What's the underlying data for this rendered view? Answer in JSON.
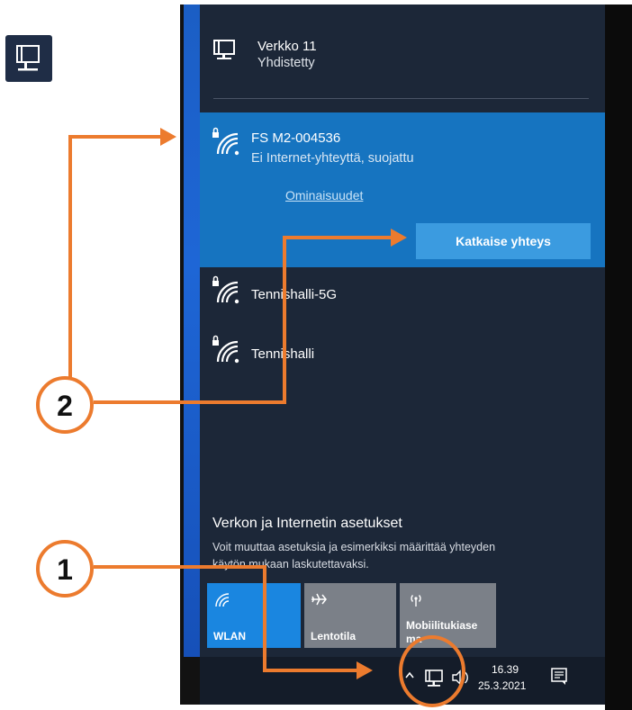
{
  "wired": {
    "name": "Verkko 11",
    "status": "Yhdistetty"
  },
  "selected_wifi": {
    "name": "FS M2-004536",
    "status": "Ei Internet-yhteyttä, suojattu",
    "properties_link": "Ominaisuudet",
    "disconnect_button": "Katkaise yhteys"
  },
  "wifi_networks": [
    {
      "name": "Tennishalli-5G"
    },
    {
      "name": "Tennishalli"
    }
  ],
  "settings": {
    "title": "Verkon ja Internetin asetukset",
    "desc_line1": "Voit muuttaa asetuksia ja esimerkiksi määrittää yhteyden",
    "desc_line2": "käytön mukaan laskutettavaksi."
  },
  "quick_tiles": [
    {
      "label": "WLAN",
      "icon": "wifi-icon",
      "active": true
    },
    {
      "label": "Lentotila",
      "icon": "airplane-icon",
      "active": false
    },
    {
      "label_line1": "Mobiilitukiase",
      "label_line2": "ma",
      "icon": "mobile-hotspot-icon",
      "active": false
    }
  ],
  "taskbar": {
    "time": "16.39",
    "date": "25.3.2021"
  },
  "callouts": {
    "first": "1",
    "second": "2"
  },
  "colors": {
    "accent": "#ec7b2e",
    "selected": "#1674c0",
    "active_tile": "#1a86e0",
    "panel": "#1c2738"
  }
}
